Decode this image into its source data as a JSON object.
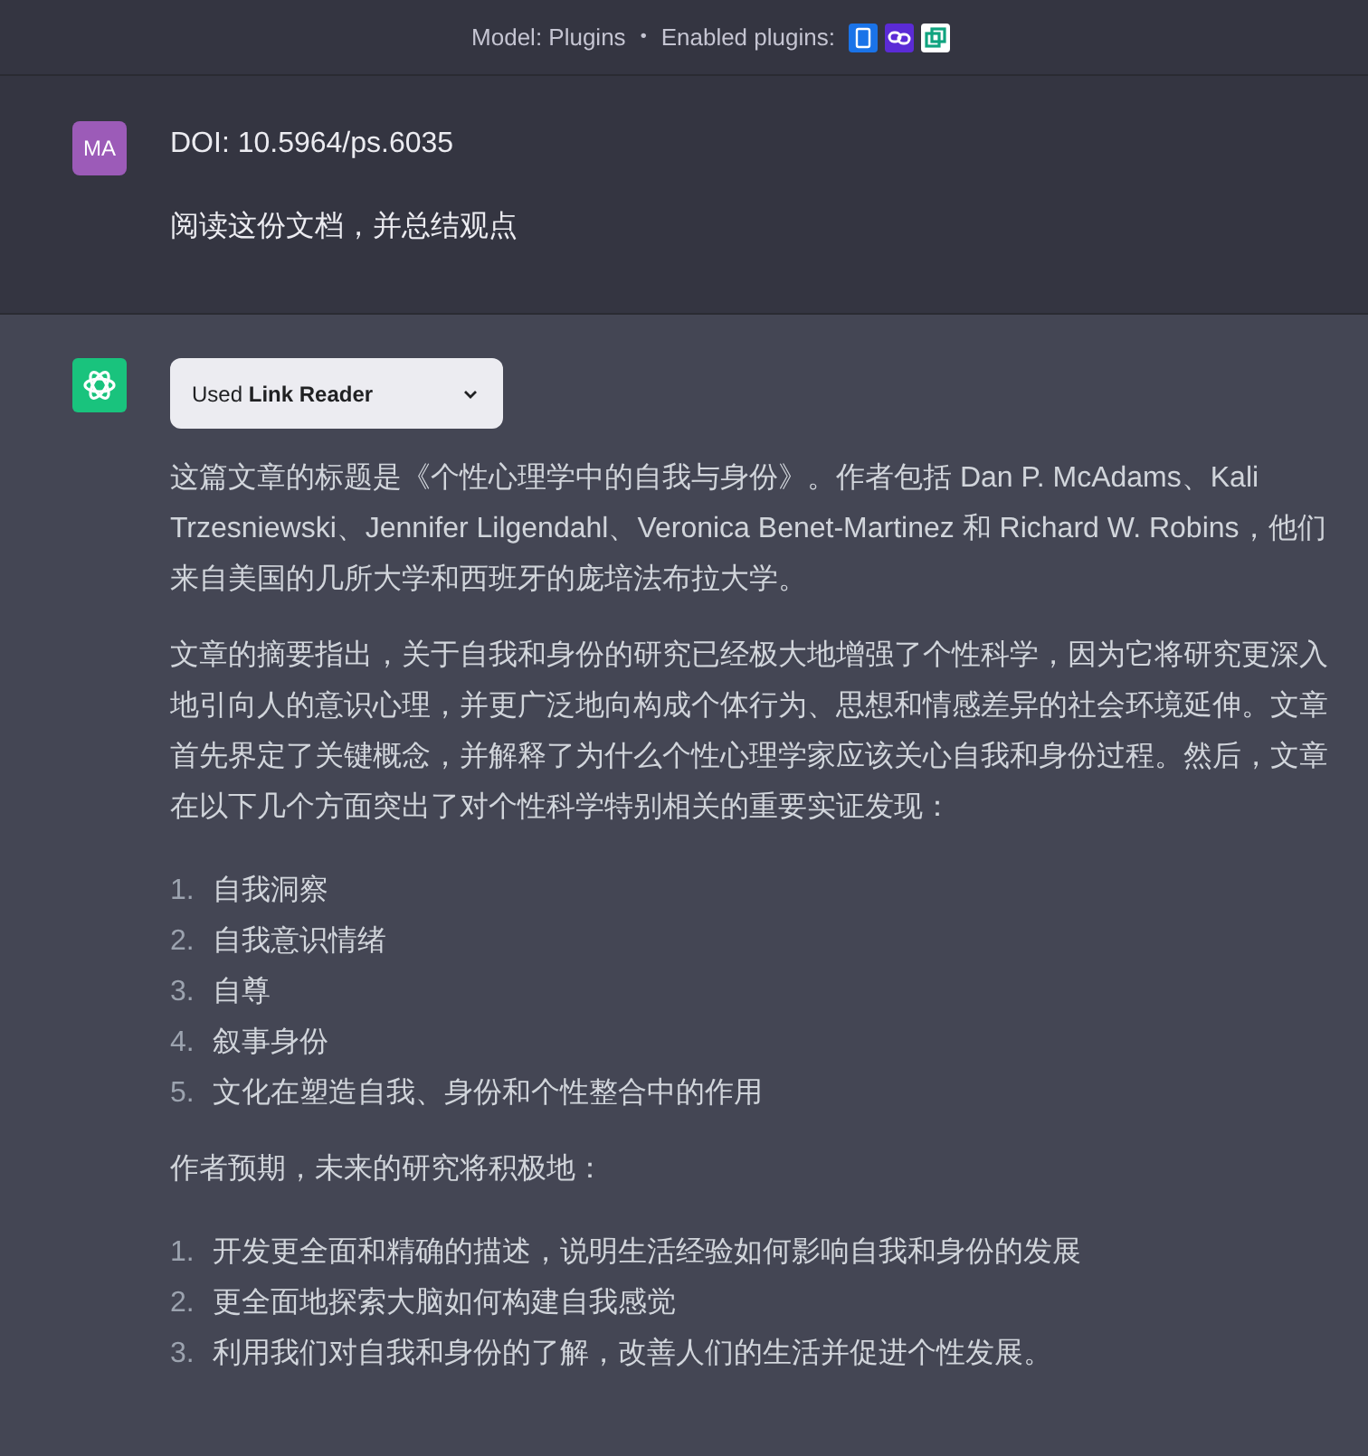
{
  "header": {
    "model": "Model: Plugins",
    "separator": "•",
    "enabled_label": "Enabled plugins:"
  },
  "user_message": {
    "avatar": "MA",
    "lines": [
      "DOI: 10.5964/ps.6035",
      "阅读这份文档，并总结观点"
    ]
  },
  "assistant_message": {
    "plugin_button": "Used **Link Reader**",
    "paragraphs": [
      {
        "kind": "text",
        "text": "这篇文章的标题是《个性心理学中的自我与身份》。作者包括 Dan P. McAdams、Kali Trzesniewski、Jennifer Lilgendahl、Veronica Benet-Martinez 和 Richard W. Robins，他们来自美国的几所大学和西班牙的庞培法布拉大学。"
      },
      {
        "kind": "text",
        "text": "文章的摘要指出，关于自我和身份的研究已经极大地增强了个性科学，因为它将研究更深入地引向人的意识心理，并更广泛地向构成个体行为、思想和情感差异的社会环境延伸。文章首先界定了关键概念，并解释了为什么个性心理学家应该关心自我和身份过程。然后，文章在以下几个方面突出了对个性科学特别相关的重要实证发现："
      },
      {
        "kind": "list",
        "items": [
          {
            "number": "1.",
            "text": "自我洞察"
          },
          {
            "number": "2.",
            "text": "自我意识情绪"
          },
          {
            "number": "3.",
            "text": "自尊"
          },
          {
            "number": "4.",
            "text": "叙事身份"
          },
          {
            "number": "5.",
            "text": "文化在塑造自我、身份和个性整合中的作用"
          }
        ]
      },
      {
        "kind": "text",
        "text": "作者预期，未来的研究将积极地："
      },
      {
        "kind": "list",
        "items": [
          {
            "number": "1.",
            "text": "开发更全面和精确的描述，说明生活经验如何影响自我和身份的发展"
          },
          {
            "number": "2.",
            "text": "更全面地探索大脑如何构建自我感觉"
          },
          {
            "number": "3.",
            "text": "利用我们对自我和身份的了解，改善人们的生活并促进个性发展。"
          }
        ]
      }
    ]
  }
}
